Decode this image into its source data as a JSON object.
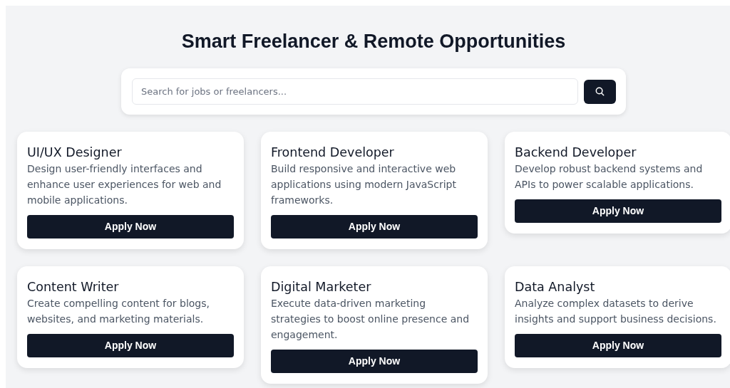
{
  "title": "Smart Freelancer & Remote Opportunities",
  "search": {
    "placeholder": "Search for jobs or freelancers..."
  },
  "jobs": [
    {
      "title": "UI/UX Designer",
      "description": "Design user-friendly interfaces and enhance user experiences for web and mobile applications.",
      "button": "Apply Now"
    },
    {
      "title": "Frontend Developer",
      "description": "Build responsive and interactive web applications using modern JavaScript frameworks.",
      "button": "Apply Now"
    },
    {
      "title": "Backend Developer",
      "description": "Develop robust backend systems and APIs to power scalable applications.",
      "button": "Apply Now"
    },
    {
      "title": "Content Writer",
      "description": "Create compelling content for blogs, websites, and marketing materials.",
      "button": "Apply Now"
    },
    {
      "title": "Digital Marketer",
      "description": "Execute data-driven marketing strategies to boost online presence and engagement.",
      "button": "Apply Now"
    },
    {
      "title": "Data Analyst",
      "description": "Analyze complex datasets to derive insights and support business decisions.",
      "button": "Apply Now"
    }
  ]
}
